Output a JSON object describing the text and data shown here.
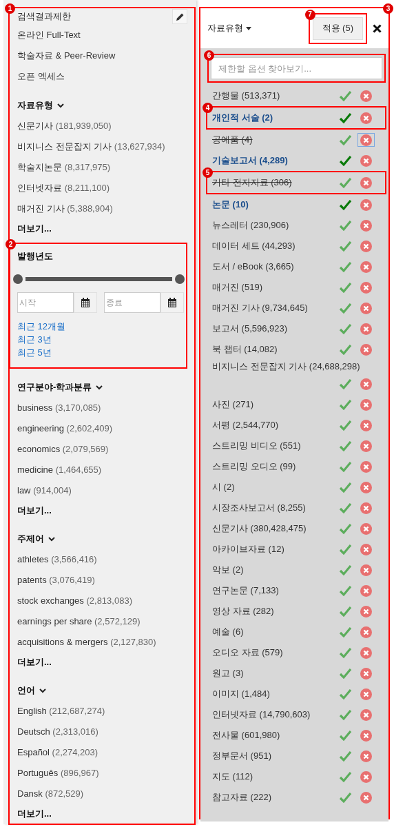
{
  "limits_panel": {
    "callout": "1",
    "title": "검색결과제한",
    "options": [
      "온라인 Full-Text",
      "학술자료 & Peer-Review",
      "오픈 엑세스"
    ],
    "groups": [
      {
        "kind": "facet",
        "title": "자료유형",
        "items": [
          {
            "label": "신문기사",
            "count": "(181,939,050)"
          },
          {
            "label": "비지니스 전문잡지 기사",
            "count": "(13,627,934)"
          },
          {
            "label": "학술지논문",
            "count": "(8,317,975)"
          },
          {
            "label": "인터넷자료",
            "count": "(8,211,100)"
          },
          {
            "label": "매거진 기사",
            "count": "(5,388,904)"
          }
        ],
        "more": "더보기..."
      },
      {
        "kind": "date",
        "callout": "2",
        "title": "발행년도",
        "handles": [
          {
            "level": 0
          },
          {
            "level": 1
          }
        ],
        "start_placeholder": "시작",
        "end_placeholder": "종료",
        "links": [
          "최근 12개월",
          "최근 3년",
          "최근 5년"
        ]
      },
      {
        "kind": "facet",
        "title": "연구분야-학과분류",
        "items": [
          {
            "label": "business",
            "count": "(3,170,085)"
          },
          {
            "label": "engineering",
            "count": "(2,602,409)"
          },
          {
            "label": "economics",
            "count": "(2,079,569)"
          },
          {
            "label": "medicine",
            "count": "(1,464,655)"
          },
          {
            "label": "law",
            "count": "(914,004)"
          }
        ],
        "more": "더보기..."
      },
      {
        "kind": "facet",
        "title": "주제어",
        "items": [
          {
            "label": "athletes",
            "count": "(3,566,416)"
          },
          {
            "label": "patents",
            "count": "(3,076,419)"
          },
          {
            "label": "stock exchanges",
            "count": "(2,813,083)"
          },
          {
            "label": "earnings per share",
            "count": "(2,572,129)"
          },
          {
            "label": "acquisitions & mergers",
            "count": "(2,127,830)"
          }
        ],
        "more": "더보기..."
      },
      {
        "kind": "facet",
        "title": "언어",
        "items": [
          {
            "label": "English",
            "count": "(212,687,274)"
          },
          {
            "label": "Deutsch",
            "count": "(2,313,016)"
          },
          {
            "label": "Español",
            "count": "(2,274,203)"
          },
          {
            "label": "Português",
            "count": "(896,967)"
          },
          {
            "label": "Dansk",
            "count": "(872,529)"
          }
        ],
        "more": "더보기..."
      }
    ]
  },
  "type_panel": {
    "callout": "3",
    "title": "자료유형",
    "apply": {
      "label": "적용 (5)",
      "callout": "7"
    },
    "search": {
      "placeholder": "제한할 옵션 찾아보기...",
      "callout": "6"
    },
    "items": [
      {
        "label": "간행물 (513,371)",
        "included": false,
        "excluded": false,
        "focused": false
      },
      {
        "label": "개인적 서술 (2)",
        "included": true,
        "excluded": false,
        "focused": false,
        "callout": "4"
      },
      {
        "label": "공예품 (4)",
        "included": false,
        "excluded": true,
        "focused": true
      },
      {
        "label": "기술보고서 (4,289)",
        "included": true,
        "excluded": false,
        "focused": false
      },
      {
        "label": "기타 전자자료 (306)",
        "included": false,
        "excluded": true,
        "focused": false,
        "callout": "5"
      },
      {
        "label": "논문 (10)",
        "included": true,
        "excluded": false,
        "focused": false
      },
      {
        "label": "뉴스레터 (230,906)",
        "included": false,
        "excluded": false,
        "focused": false
      },
      {
        "label": "데이터 세트 (44,293)",
        "included": false,
        "excluded": false,
        "focused": false
      },
      {
        "label": "도서 / eBook (3,665)",
        "included": false,
        "excluded": false,
        "focused": false
      },
      {
        "label": "매거진 (519)",
        "included": false,
        "excluded": false,
        "focused": false
      },
      {
        "label": "매거진 기사 (9,734,645)",
        "included": false,
        "excluded": false,
        "focused": false
      },
      {
        "label": "보고서 (5,596,923)",
        "included": false,
        "excluded": false,
        "focused": false
      },
      {
        "label": "북 챕터 (14,082)",
        "included": false,
        "excluded": false,
        "focused": false
      },
      {
        "label": "비지니스 전문잡지 기사 (24,688,298)",
        "included": false,
        "excluded": false,
        "focused": false
      },
      {
        "label": "사진 (271)",
        "included": false,
        "excluded": false,
        "focused": false
      },
      {
        "label": "서평 (2,544,770)",
        "included": false,
        "excluded": false,
        "focused": false
      },
      {
        "label": "스트리밍 비디오 (551)",
        "included": false,
        "excluded": false,
        "focused": false
      },
      {
        "label": "스트리밍 오디오 (99)",
        "included": false,
        "excluded": false,
        "focused": false
      },
      {
        "label": "시 (2)",
        "included": false,
        "excluded": false,
        "focused": false
      },
      {
        "label": "시장조사보고서 (8,255)",
        "included": false,
        "excluded": false,
        "focused": false
      },
      {
        "label": "신문기사 (380,428,475)",
        "included": false,
        "excluded": false,
        "focused": false
      },
      {
        "label": "아카이브자료 (12)",
        "included": false,
        "excluded": false,
        "focused": false
      },
      {
        "label": "악보 (2)",
        "included": false,
        "excluded": false,
        "focused": false
      },
      {
        "label": "연구논문 (7,133)",
        "included": false,
        "excluded": false,
        "focused": false
      },
      {
        "label": "영상 자료 (282)",
        "included": false,
        "excluded": false,
        "focused": false
      },
      {
        "label": "예술 (6)",
        "included": false,
        "excluded": false,
        "focused": false
      },
      {
        "label": "오디오 자료 (579)",
        "included": false,
        "excluded": false,
        "focused": false
      },
      {
        "label": "원고 (3)",
        "included": false,
        "excluded": false,
        "focused": false
      },
      {
        "label": "이미지 (1,484)",
        "included": false,
        "excluded": false,
        "focused": false
      },
      {
        "label": "인터넷자료 (14,790,603)",
        "included": false,
        "excluded": false,
        "focused": false
      },
      {
        "label": "전사물 (601,980)",
        "included": false,
        "excluded": false,
        "focused": false
      },
      {
        "label": "정부문서 (951)",
        "included": false,
        "excluded": false,
        "focused": false
      },
      {
        "label": "지도 (112)",
        "included": false,
        "excluded": false,
        "focused": false
      },
      {
        "label": "참고자료 (222)",
        "included": false,
        "excluded": false,
        "focused": false
      }
    ]
  }
}
